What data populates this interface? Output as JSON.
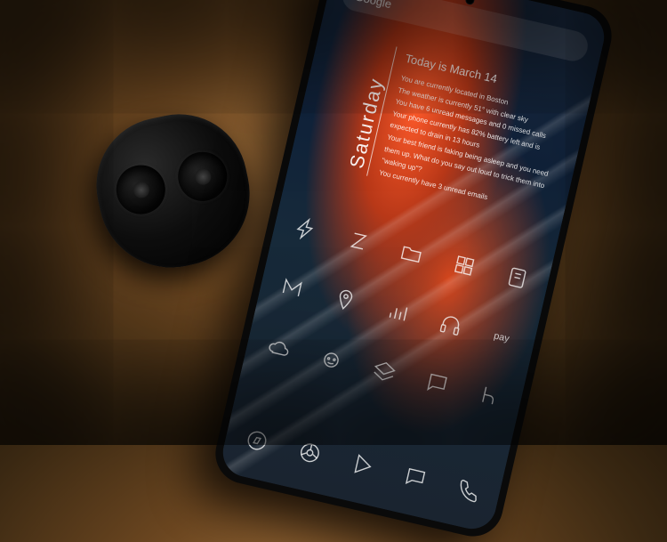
{
  "search": {
    "label": "Google"
  },
  "info": {
    "day": "Saturday",
    "title": "Today is March 14",
    "lines": [
      "You are currently located in Boston",
      "The weather is currently 51° with clear sky",
      "You have 6 unread messages and 0 missed calls",
      "Your phone currently has 82% battery left and is expected to drain in 13 hours",
      "Your best friend is faking being asleep and you need them up. What do you say out loud to trick them into \"waking up\"?",
      "You currently have 3 unread emails"
    ]
  },
  "icons": {
    "row1": [
      "lightning-icon",
      "z-icon",
      "folder-icon",
      "grid-icon",
      "note-icon"
    ],
    "row2": [
      "m-icon",
      "pin-icon",
      "bars-icon",
      "headphones-icon",
      "pay-icon"
    ],
    "row3": [
      "cloud-icon",
      "reddit-icon",
      "layers-icon",
      "chat-icon",
      "hulu-icon"
    ],
    "dock": [
      "compass-icon",
      "chrome-icon",
      "play-icon",
      "messages-icon",
      "phone-icon"
    ]
  }
}
